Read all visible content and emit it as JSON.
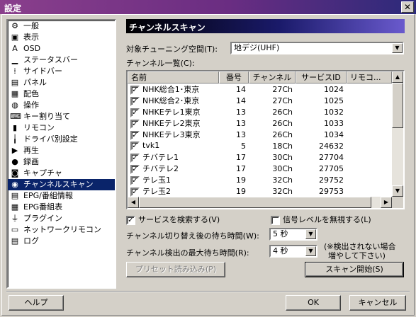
{
  "window": {
    "title": "設定",
    "close_glyph": "✕"
  },
  "sidebar": {
    "items": [
      {
        "label": "一般",
        "icon": "gear-icon",
        "glyph": "⚙"
      },
      {
        "label": "表示",
        "icon": "window-icon",
        "glyph": "▣"
      },
      {
        "label": "OSD",
        "icon": "osd-icon",
        "glyph": "A"
      },
      {
        "label": "ステータスバー",
        "icon": "statusbar-icon",
        "glyph": "▁"
      },
      {
        "label": "サイドバー",
        "icon": "sidebar-icon",
        "glyph": "⁞"
      },
      {
        "label": "パネル",
        "icon": "panel-icon",
        "glyph": "▤"
      },
      {
        "label": "配色",
        "icon": "palette-icon",
        "glyph": "▦"
      },
      {
        "label": "操作",
        "icon": "mouse-icon",
        "glyph": "◍"
      },
      {
        "label": "キー割り当て",
        "icon": "keyboard-icon",
        "glyph": "⌨"
      },
      {
        "label": "リモコン",
        "icon": "remote-icon",
        "glyph": "▮"
      },
      {
        "label": "ドライバ別設定",
        "icon": "driver-icon",
        "glyph": "╽"
      },
      {
        "label": "再生",
        "icon": "play-icon",
        "glyph": "▶"
      },
      {
        "label": "録画",
        "icon": "record-icon",
        "glyph": "●"
      },
      {
        "label": "キャプチャ",
        "icon": "camera-icon",
        "glyph": "◙"
      },
      {
        "label": "チャンネルスキャン",
        "icon": "scan-icon",
        "glyph": "◉",
        "selected": true
      },
      {
        "label": "EPG/番組情報",
        "icon": "epg-icon",
        "glyph": "▤"
      },
      {
        "label": "EPG番組表",
        "icon": "grid-icon",
        "glyph": "▦"
      },
      {
        "label": "プラグイン",
        "icon": "plug-icon",
        "glyph": "⏚"
      },
      {
        "label": "ネットワークリモコン",
        "icon": "network-icon",
        "glyph": "▭"
      },
      {
        "label": "ログ",
        "icon": "log-icon",
        "glyph": "▤"
      }
    ]
  },
  "panel": {
    "title": "チャンネルスキャン",
    "tuning_space_label": "対象チューニング空間(T):",
    "tuning_space_value": "地デジ(UHF)",
    "channel_list_label": "チャンネル一覧(C):",
    "columns": [
      "名前",
      "番号",
      "チャンネル",
      "サービスID",
      "リモコ..."
    ],
    "channels": [
      {
        "checked": true,
        "name": "NHK総合1･東京",
        "number": "14",
        "channel": "27Ch",
        "service_id": "1024"
      },
      {
        "checked": true,
        "name": "NHK総合2･東京",
        "number": "14",
        "channel": "27Ch",
        "service_id": "1025"
      },
      {
        "checked": true,
        "name": "NHKEテレ1東京",
        "number": "13",
        "channel": "26Ch",
        "service_id": "1032"
      },
      {
        "checked": true,
        "name": "NHKEテレ2東京",
        "number": "13",
        "channel": "26Ch",
        "service_id": "1033"
      },
      {
        "checked": true,
        "name": "NHKEテレ3東京",
        "number": "13",
        "channel": "26Ch",
        "service_id": "1034"
      },
      {
        "checked": true,
        "name": "tvk1",
        "number": "5",
        "channel": "18Ch",
        "service_id": "24632"
      },
      {
        "checked": true,
        "name": "チバテレ1",
        "number": "17",
        "channel": "30Ch",
        "service_id": "27704"
      },
      {
        "checked": true,
        "name": "チバテレ2",
        "number": "17",
        "channel": "30Ch",
        "service_id": "27705"
      },
      {
        "checked": true,
        "name": "テレ玉1",
        "number": "19",
        "channel": "32Ch",
        "service_id": "29752"
      },
      {
        "checked": true,
        "name": "テレ玉2",
        "number": "19",
        "channel": "32Ch",
        "service_id": "29753"
      }
    ],
    "search_services_label": "サービスを検索する(V)",
    "search_services_checked": true,
    "ignore_signal_label": "信号レベルを無視する(L)",
    "ignore_signal_checked": false,
    "wait_after_switch_label": "チャンネル切り替え後の待ち時間(W):",
    "wait_after_switch_value": "5 秒",
    "max_wait_label": "チャンネル検出の最大待ち時間(R):",
    "max_wait_value": "4 秒",
    "note_line1": "(※検出されない場合",
    "note_line2": "増やして下さい)",
    "preset_button": "プリセット読み込み(P)",
    "scan_button": "スキャン開始(S)"
  },
  "footer": {
    "help_button": "ヘルプ",
    "ok_button": "OK",
    "cancel_button": "キャンセル"
  }
}
